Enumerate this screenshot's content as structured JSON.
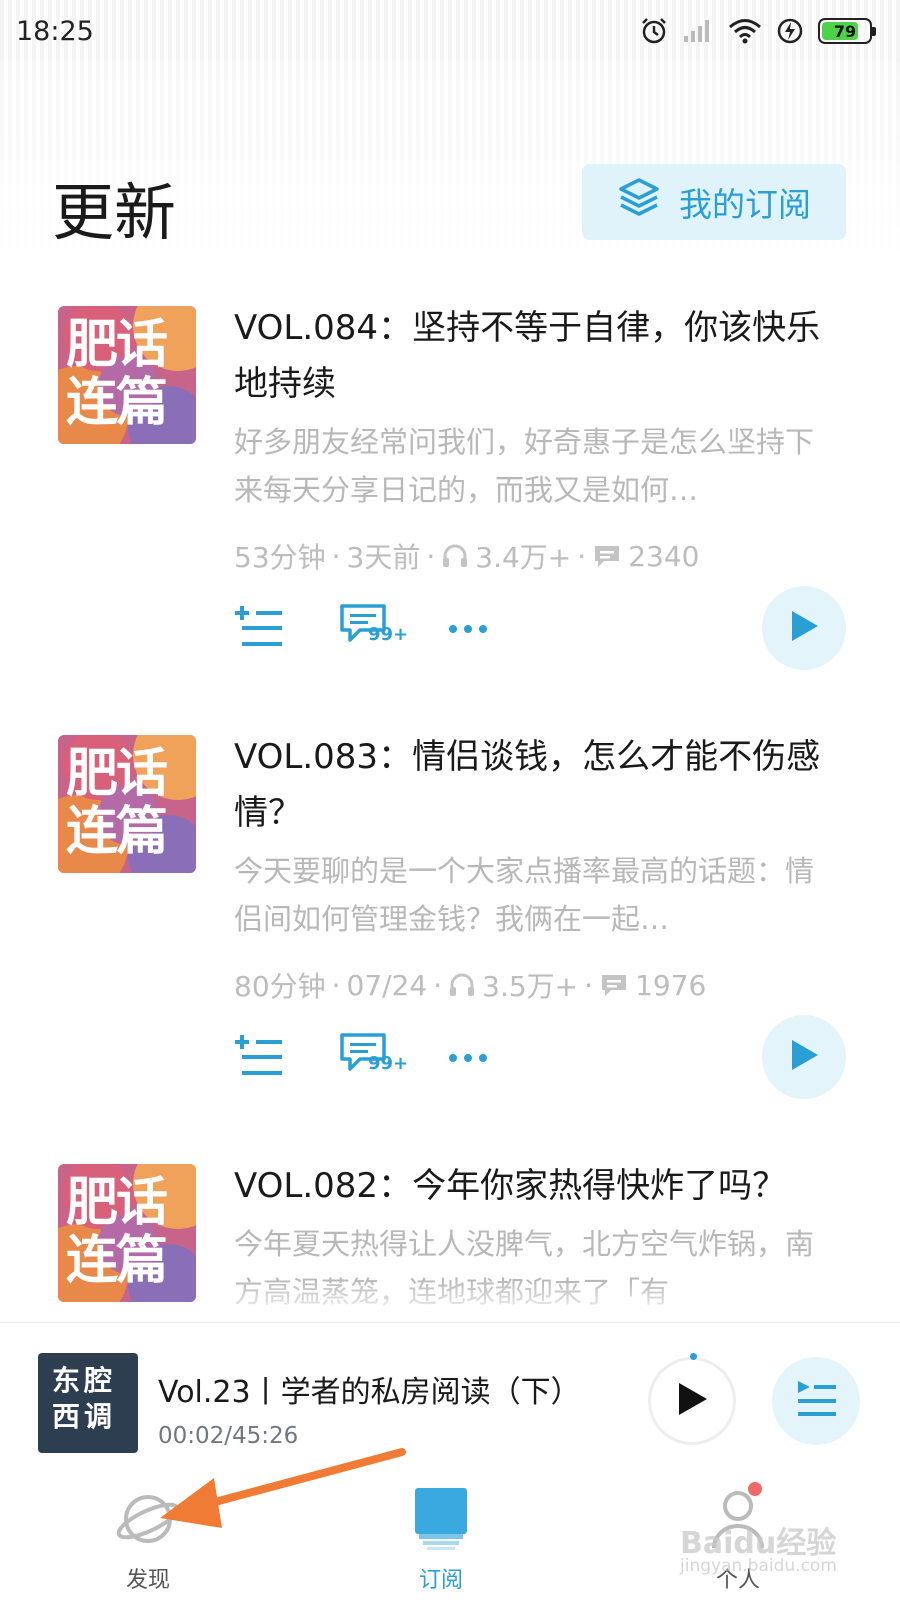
{
  "status_bar": {
    "time": "18:25",
    "battery": "79",
    "battery_level": 0.79,
    "icons": [
      "alarm-icon",
      "signal-icon",
      "wifi-icon",
      "charging-icon",
      "battery-icon"
    ]
  },
  "header": {
    "title": "更新",
    "subscriptions_button": "我的订阅",
    "subscriptions_icon": "layers-icon"
  },
  "episodes": [
    {
      "title": "VOL.084：坚持不等于自律，你该快乐地持续",
      "description": "好多朋友经常问我们，好奇惠子是怎么坚持下来每天分享日记的，而我又是如何…",
      "duration": "53分钟",
      "date": "3天前",
      "plays": "3.4万+",
      "comments": "2340",
      "comment_badge": "99+",
      "cover_text": "肥话连篇"
    },
    {
      "title": "VOL.083：情侣谈钱，怎么才能不伤感情？",
      "description": "今天要聊的是一个大家点播率最高的话题：情侣间如何管理金钱？我俩在一起…",
      "duration": "80分钟",
      "date": "07/24",
      "plays": "3.5万+",
      "comments": "1976",
      "comment_badge": "99+",
      "cover_text": "肥话连篇"
    },
    {
      "title": "VOL.082：今年你家热得快炸了吗？",
      "description": "今年夏天热得让人没脾气，北方空气炸锅，南方高温蒸笼，连地球都迎来了「有",
      "cover_text": "肥话连篇"
    }
  ],
  "mini_player": {
    "cover_text": "东腔西调",
    "title": "Vol.23丨学者的私房阅读（下）",
    "time": "00:02/45:26",
    "progress": 0.0007
  },
  "tabs": [
    {
      "label": "发现",
      "icon": "planet-icon",
      "active": false
    },
    {
      "label": "订阅",
      "icon": "subscription-icon",
      "active": true
    },
    {
      "label": "个人",
      "icon": "person-icon",
      "active": false
    }
  ],
  "watermark": {
    "text": "Baidu经验",
    "sub": "jingyan.baidu.com"
  },
  "colors": {
    "accent": "#2a9fd6",
    "accent_light": "#e4f4fb",
    "arrow": "#f07b35"
  }
}
